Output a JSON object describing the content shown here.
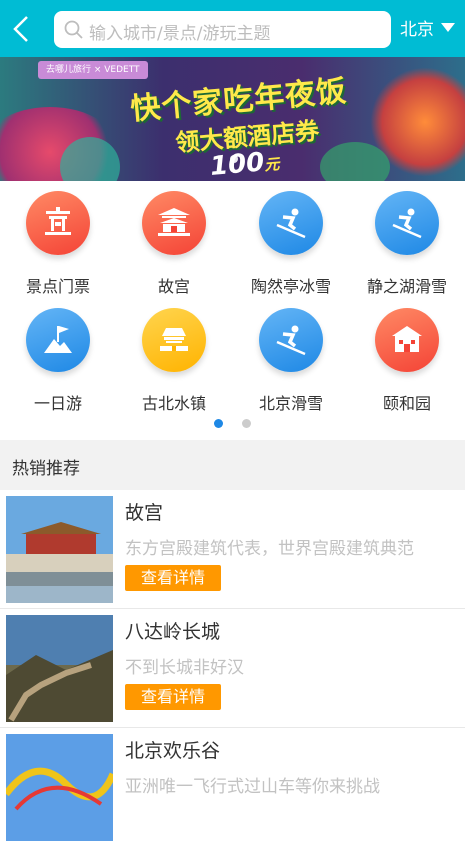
{
  "header": {
    "search_placeholder": "输入城市/景点/游玩主题",
    "city": "北京"
  },
  "banner": {
    "brand": "去哪儿旅行 × VEDETT",
    "headline": "快个家吃年夜饭",
    "subline": "领大额酒店券",
    "amount": "100",
    "unit": "元",
    "slide_count": 1
  },
  "categories": [
    {
      "label": "景点门票",
      "icon": "pagoda-icon",
      "color": "red"
    },
    {
      "label": "故宫",
      "icon": "palace-icon",
      "color": "red"
    },
    {
      "label": "陶然亭冰雪",
      "icon": "skier-icon",
      "color": "blue"
    },
    {
      "label": "静之湖滑雪",
      "icon": "skier-icon",
      "color": "blue"
    },
    {
      "label": "一日游",
      "icon": "mountain-flag-icon",
      "color": "blue"
    },
    {
      "label": "古北水镇",
      "icon": "town-gate-icon",
      "color": "yellow"
    },
    {
      "label": "北京滑雪",
      "icon": "skier-icon",
      "color": "blue"
    },
    {
      "label": "颐和园",
      "icon": "house-icon",
      "color": "red"
    }
  ],
  "category_pages": {
    "count": 2,
    "active": 0
  },
  "hot": {
    "title": "热销推荐",
    "items": [
      {
        "name": "故宫",
        "desc": "东方宫殿建筑代表，世界宫殿建筑典范",
        "button": "查看详情"
      },
      {
        "name": "八达岭长城",
        "desc": "不到长城非好汉",
        "button": "查看详情"
      },
      {
        "name": "北京欢乐谷",
        "desc": "亚洲唯一飞行式过山车等你来挑战",
        "button": ""
      }
    ]
  }
}
